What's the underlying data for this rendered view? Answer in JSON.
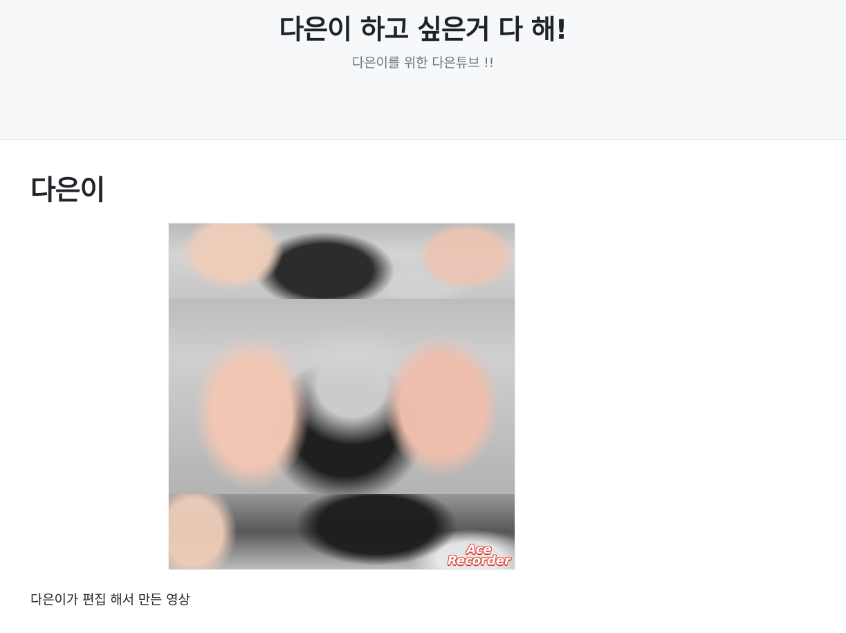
{
  "hero": {
    "title": "다은이 하고 싶은거 다 해!",
    "subtitle": "다은이를 위한 다은튜브 !!"
  },
  "section": {
    "title": "다은이"
  },
  "video": {
    "watermark_line1": "Ace",
    "watermark_line2": "Recorder"
  },
  "caption": {
    "text": "다은이가 편집 해서 만든 영상"
  }
}
